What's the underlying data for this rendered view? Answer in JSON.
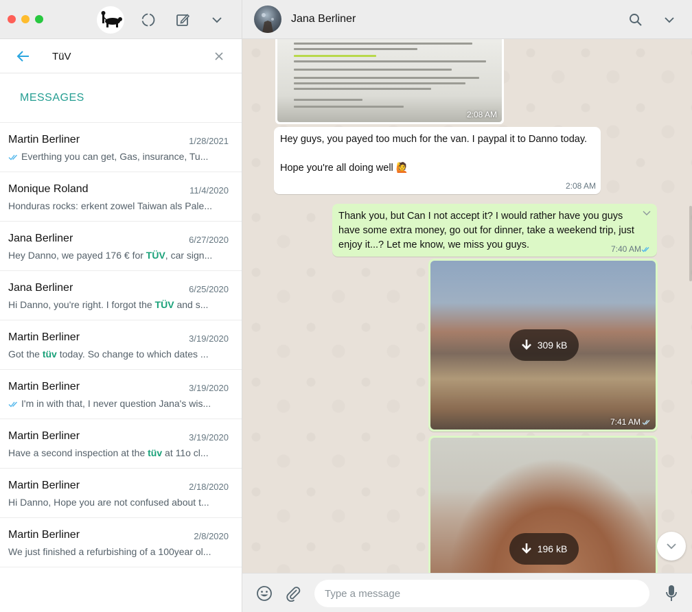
{
  "left_header": {
    "icons": [
      "avatar",
      "status-icon",
      "new-chat-icon",
      "chevron-down-icon"
    ]
  },
  "search": {
    "value": "TüV",
    "clear_icon": "close-icon",
    "back_icon": "back-arrow-icon"
  },
  "section": {
    "label": "MESSAGES"
  },
  "results": [
    {
      "name": "Martin Berliner",
      "date": "1/28/2021",
      "ticks": true,
      "pre": "Everthing you can get, Gas, insurance, Tu...",
      "hl": "",
      "post": ""
    },
    {
      "name": "Monique Roland",
      "date": "11/4/2020",
      "ticks": false,
      "pre": "Honduras rocks: erkent zowel Taiwan als Pale...",
      "hl": "",
      "post": ""
    },
    {
      "name": "Jana Berliner",
      "date": "6/27/2020",
      "ticks": false,
      "pre": "Hey Danno, we payed 176 € for ",
      "hl": "TÜV",
      "post": ", car sign..."
    },
    {
      "name": "Jana Berliner",
      "date": "6/25/2020",
      "ticks": false,
      "pre": "Hi Danno, you're right. I forgot the ",
      "hl": "TÜV",
      "post": " and s..."
    },
    {
      "name": "Martin Berliner",
      "date": "3/19/2020",
      "ticks": false,
      "pre": "Got the ",
      "hl": "tüv",
      "post": " today. So change to which dates ..."
    },
    {
      "name": "Martin Berliner",
      "date": "3/19/2020",
      "ticks": true,
      "pre": "I'm in with that, I never question Jana's wis...",
      "hl": "",
      "post": ""
    },
    {
      "name": "Martin Berliner",
      "date": "3/19/2020",
      "ticks": false,
      "pre": "Have a  second inspection at the ",
      "hl": "tüv",
      "post": " at 11o cl..."
    },
    {
      "name": "Martin Berliner",
      "date": "2/18/2020",
      "ticks": false,
      "pre": "Hi Danno, Hope you are not confused about t...",
      "hl": "",
      "post": ""
    },
    {
      "name": "Martin Berliner",
      "date": "2/8/2020",
      "ticks": false,
      "pre": "We just finished a refurbishing of a 100year ol...",
      "hl": "",
      "post": ""
    }
  ],
  "chat_header": {
    "name": "Jana Berliner",
    "icons": [
      "search-icon",
      "chevron-down-icon"
    ]
  },
  "messages": {
    "doc_time": "2:08 AM",
    "in_line1": "Hey guys, you payed too much for the van. I paypal it to Danno today.",
    "in_line2": "Hope you're all doing well 🙋",
    "in_time": "2:08 AM",
    "out_text": "Thank you, but Can I not accept it? I would rather have you guys have some extra money, go out for dinner, take a weekend trip, just enjoy it...? Let me know, we miss you guys.",
    "out_time": "7:40 AM",
    "img1_size": "309 kB",
    "img1_time": "7:41 AM",
    "img2_size": "196 kB"
  },
  "composer": {
    "placeholder": "Type a message",
    "icons": [
      "emoji-icon",
      "attach-icon",
      "mic-icon"
    ]
  },
  "colors": {
    "accent": "#259e92",
    "highlight": "#1aa179",
    "outgoing": "#dcf8c6",
    "incoming": "#ffffff",
    "read_ticks": "#4fb6ec"
  }
}
